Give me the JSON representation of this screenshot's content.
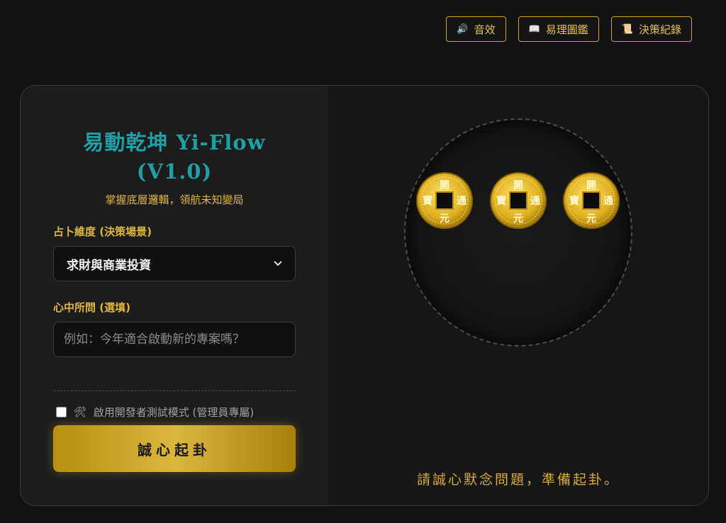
{
  "topbar": {
    "buttons": [
      {
        "icon": "speaker-icon",
        "glyph": "🔊",
        "label": "音效"
      },
      {
        "icon": "book-icon",
        "glyph": "📖",
        "label": "易理圖鑑"
      },
      {
        "icon": "scroll-icon",
        "glyph": "📜",
        "label": "決策紀錄"
      }
    ]
  },
  "app": {
    "title_line1": "易動乾坤 Yi-Flow",
    "title_line2": "(V1.0)",
    "subtitle": "掌握底層邏輯，領航未知變局"
  },
  "form": {
    "scenario_label": "占卜維度 (決策場景)",
    "scenario_value": "求財與商業投資",
    "question_label": "心中所問 (選填)",
    "question_value": "",
    "question_placeholder": "例如：今年適合啟動新的專案嗎？",
    "dev_mode_label": "啟用開發者測試模式 (管理員專屬)",
    "dev_mode_checked": false,
    "cast_button_label": "誠心起卦"
  },
  "coins": [
    {
      "top": "開",
      "bottom": "元",
      "left": "寶",
      "right": "通"
    },
    {
      "top": "開",
      "bottom": "元",
      "left": "寶",
      "right": "通"
    },
    {
      "top": "開",
      "bottom": "元",
      "left": "寶",
      "right": "通"
    }
  ],
  "status_text": "請誠心默念問題，準備起卦。",
  "colors": {
    "accent_gold": "#e0b53b",
    "title_teal": "#1f9fa6",
    "background": "#121212"
  }
}
